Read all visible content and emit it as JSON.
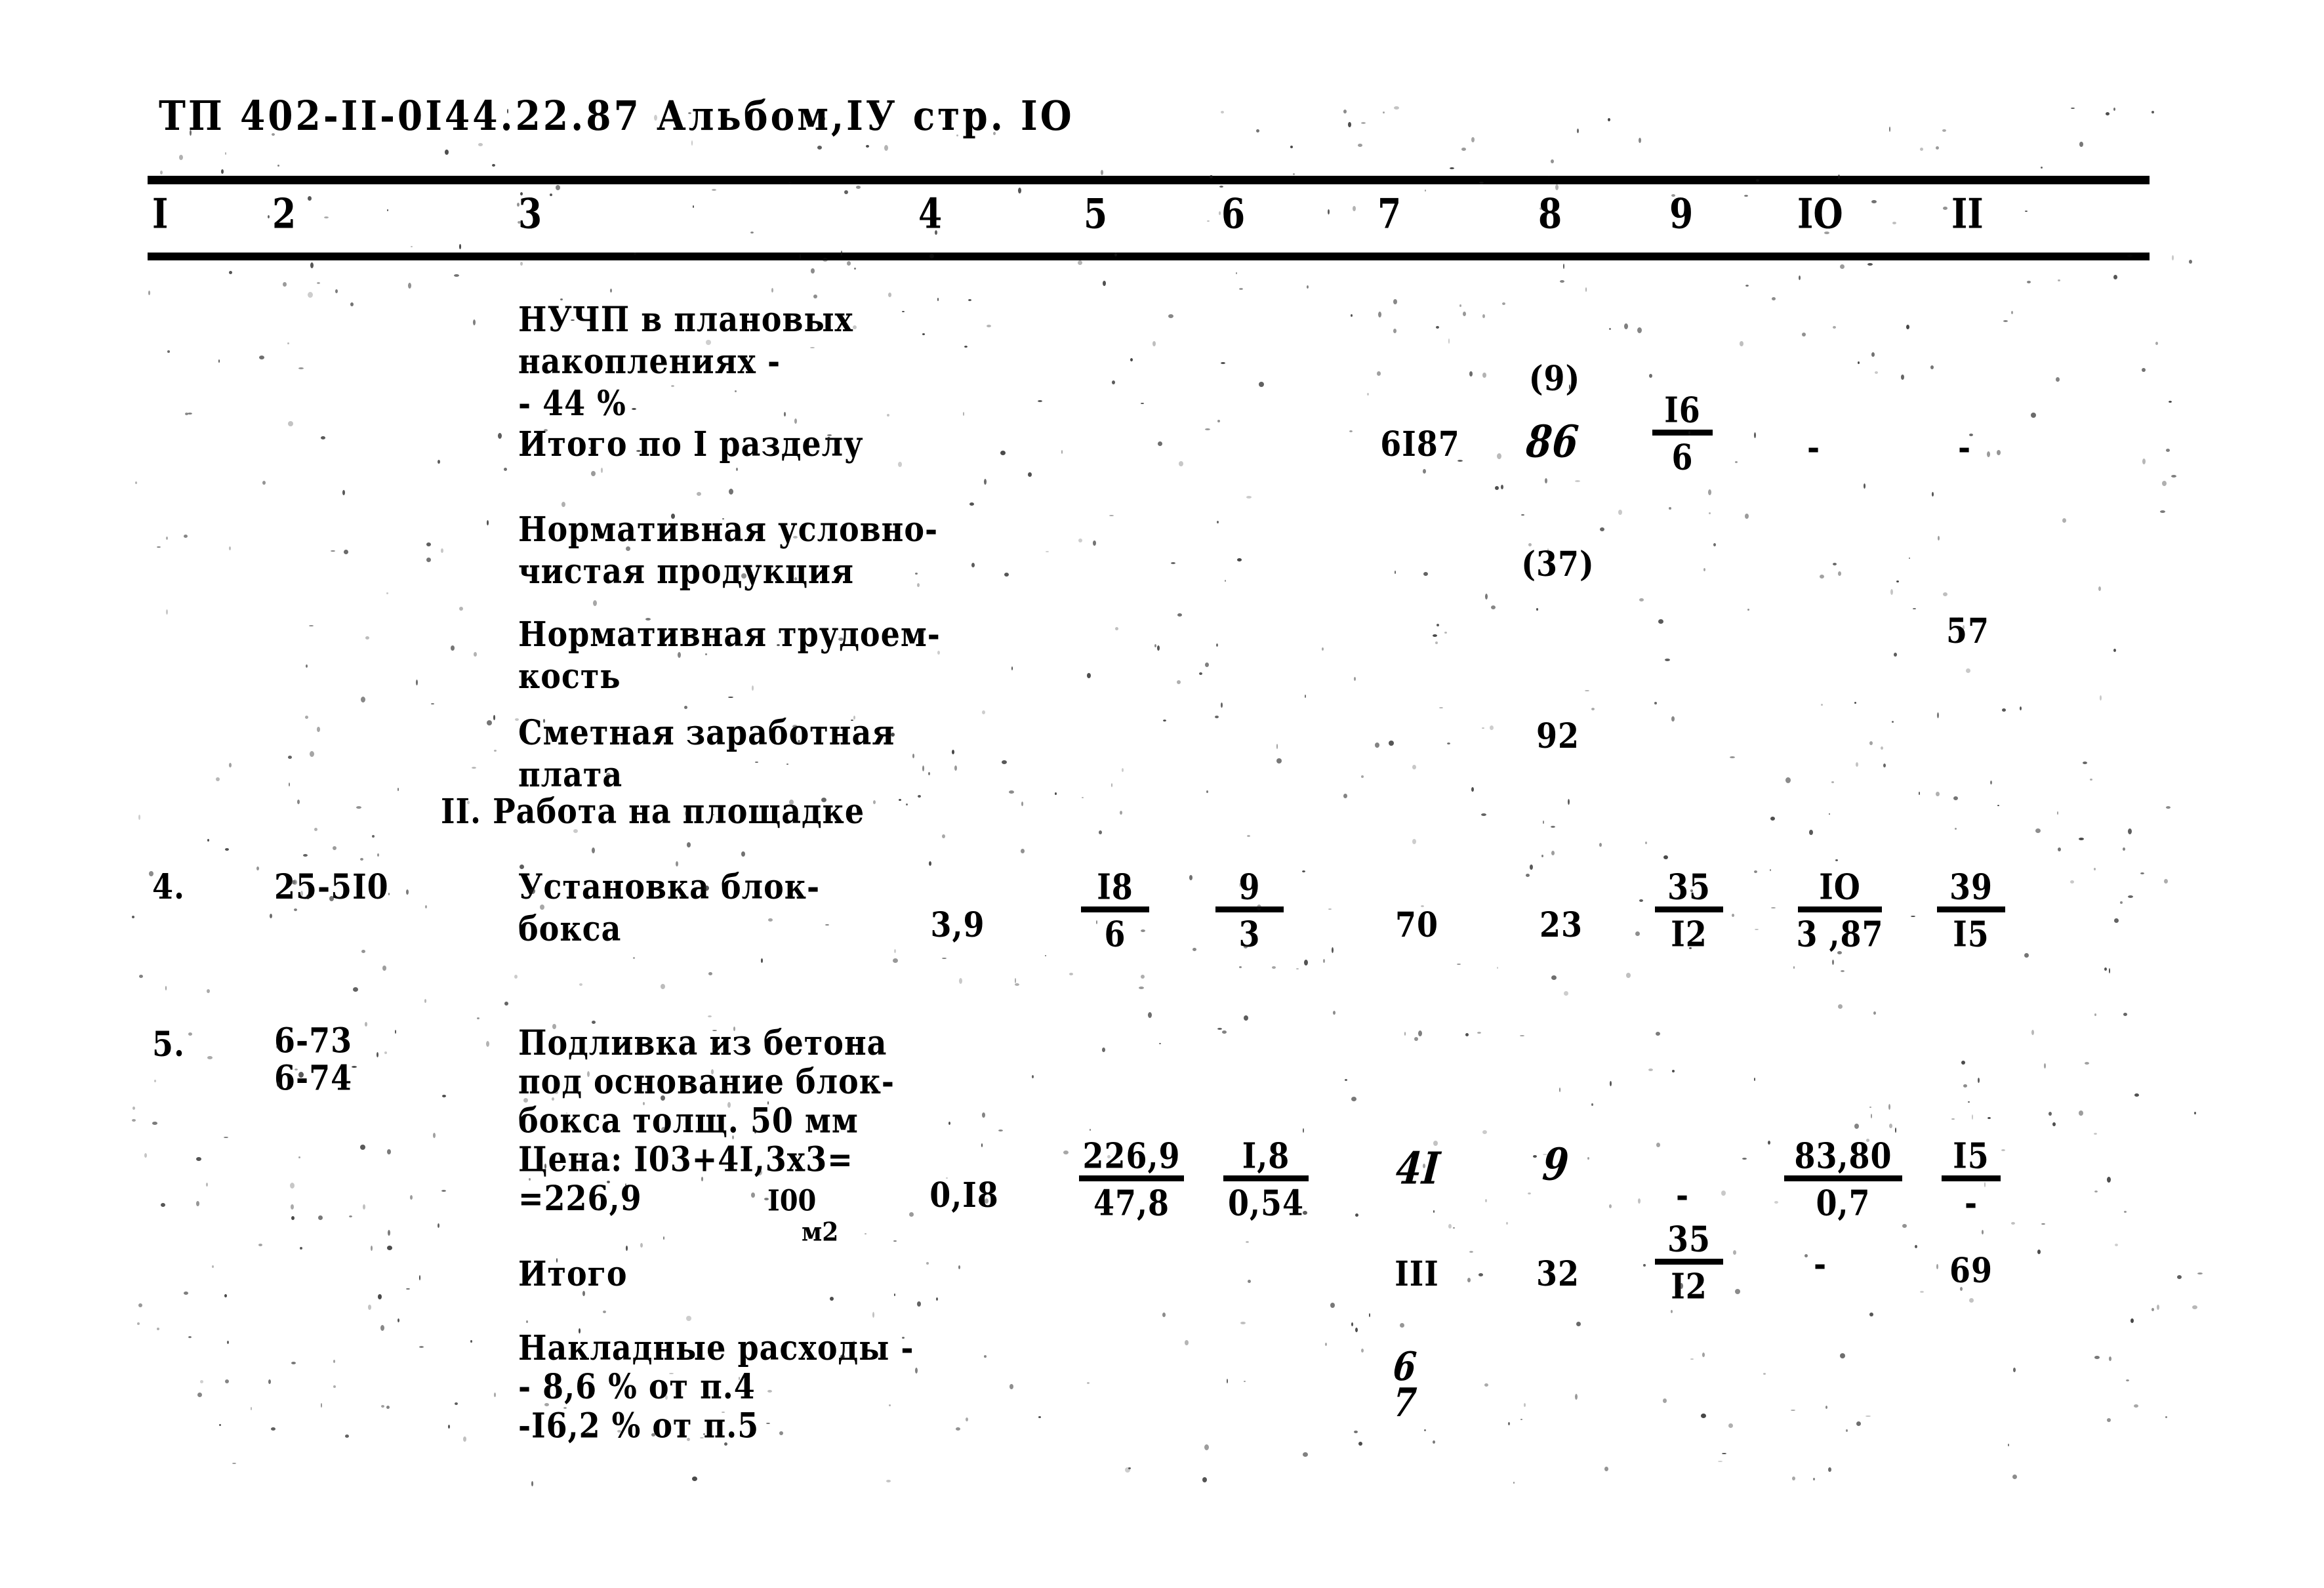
{
  "document": {
    "header": "ТП 402-II-0I44.22.87 Альбом,IУ стр. IO"
  },
  "table": {
    "column_headers": [
      "I",
      "2",
      "3",
      "4",
      "5",
      "6",
      "7",
      "8",
      "9",
      "IO",
      "II"
    ],
    "rows": [
      {
        "id": "nuchp",
        "no": "",
        "code": "",
        "description": "НУЧП в плановых\nнакоплениях -\n- 44 %",
        "c4": "",
        "c5_num": "",
        "c5_den": "",
        "c6_num": "",
        "c6_den": "",
        "c7": "",
        "c8": "(9)",
        "c9_num": "",
        "c9_den": "",
        "c10_num": "",
        "c10_den": "",
        "c11_num": "",
        "c11_den": ""
      },
      {
        "id": "itogo-razdel-1",
        "no": "",
        "code": "",
        "description": "Итого по I разделу",
        "c4": "",
        "c5_num": "",
        "c5_den": "",
        "c6_num": "",
        "c6_den": "",
        "c7": "6I87",
        "c8": "86",
        "c9_num": "I6",
        "c9_den": "6",
        "c10": "-",
        "c11": "-"
      },
      {
        "id": "normativnaya-uslovno-chistaya",
        "no": "",
        "code": "",
        "description": "Нормативная условно-\nчистая продукция",
        "c8": "(37)"
      },
      {
        "id": "normativnaya-trudoemkost",
        "no": "",
        "code": "",
        "description": "Нормативная трудоем-\nкость",
        "c11": "57"
      },
      {
        "id": "smetnaya-zarplata",
        "no": "",
        "code": "",
        "description": "Сметная заработная\nплата",
        "c8": "92"
      },
      {
        "id": "section-2",
        "section_title": "II. Работа на площадке"
      },
      {
        "id": "row-4",
        "no": "4.",
        "code": "25-5I0",
        "description": "Установка блок-\nбокса",
        "c4": "3,9",
        "c5_num": "I8",
        "c5_den": "6",
        "c6_num": "9",
        "c6_den": "3",
        "c7": "70",
        "c8": "23",
        "c9_num": "35",
        "c9_den": "I2",
        "c10_num": "IO",
        "c10_den": "3 ,87",
        "c11_num": "39",
        "c11_den": "I5"
      },
      {
        "id": "row-5",
        "no": "5.",
        "code": "6-73\n6-74",
        "description": "Подливка из бетона\nпод основание блок-\nбокса толщ. 50 мм\nЦена: I03+4I,3х3=\n                  =226,9",
        "unit_num": "I00",
        "unit_den": "м2",
        "c4": "0,I8",
        "c5_num": "226,9",
        "c5_den": "47,8",
        "c6_num": "I,8",
        "c6_den": "0,54",
        "c7": "4I",
        "c8": "9",
        "c9": "-",
        "c10_num": "83,80",
        "c10_den": "0,7",
        "c11_num": "I5",
        "c11_den": "-"
      },
      {
        "id": "itogo-2",
        "no": "",
        "code": "",
        "description": "Итого",
        "c7": "III",
        "c8": "32",
        "c9_num": "35",
        "c9_den": "I2",
        "c10": "-",
        "c11": "69"
      },
      {
        "id": "nakladnye-raskhody",
        "no": "",
        "code": "",
        "description": "Накладные расходы -\n- 8,6 % от п.4\n-I6,2 % от п.5",
        "c7_num": "6",
        "c7_den": "7"
      }
    ]
  }
}
